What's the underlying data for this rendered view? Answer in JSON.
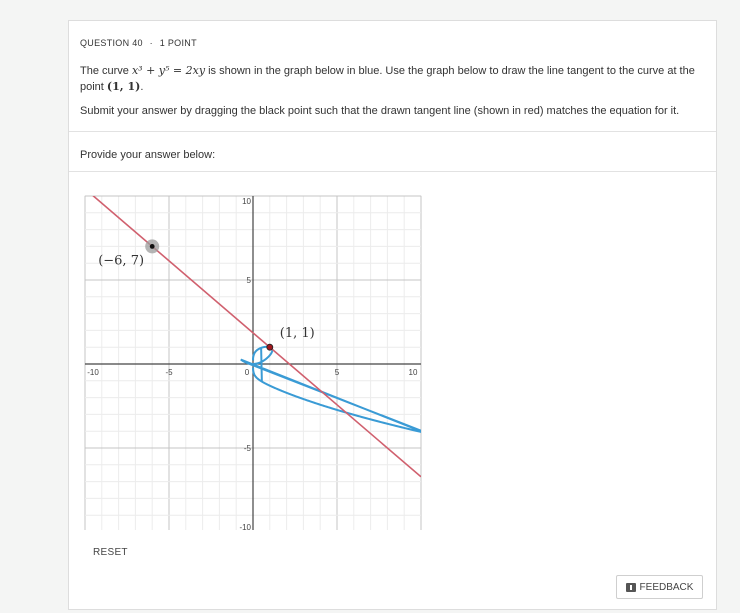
{
  "question": {
    "number_label": "QUESTION 40",
    "separator": "·",
    "points_label": "1 POINT",
    "text_before": "The curve ",
    "equation": "x³ + y⁵ = 2xy",
    "text_middle": " is shown in the graph below in blue. Use the graph below to draw the line tangent to the curve at the point ",
    "point": "(1, 1)",
    "text_end": ".",
    "instructions": "Submit your answer by dragging the black point such that the drawn tangent line (shown in red) matches the equation for it.",
    "provide_label": "Provide your answer below:"
  },
  "graph": {
    "x_ticks": [
      "-10",
      "-5",
      "0",
      "5",
      "10"
    ],
    "y_ticks": [
      "10",
      "5",
      "-5",
      "-10"
    ],
    "xlim": [
      -10,
      10
    ],
    "ylim": [
      -10,
      10
    ],
    "grid": true,
    "tangent_point_label": "(1, 1)",
    "handle_point_label": "(−6, 7)",
    "curve_color": "#3a9bd5",
    "tangent_color": "#d0606e",
    "tangent_point": [
      1,
      1
    ],
    "handle_point": [
      -6,
      7
    ]
  },
  "actions": {
    "reset_label": "RESET",
    "feedback_label": "FEEDBACK",
    "feedback_icon": "feedback-flag-icon"
  }
}
